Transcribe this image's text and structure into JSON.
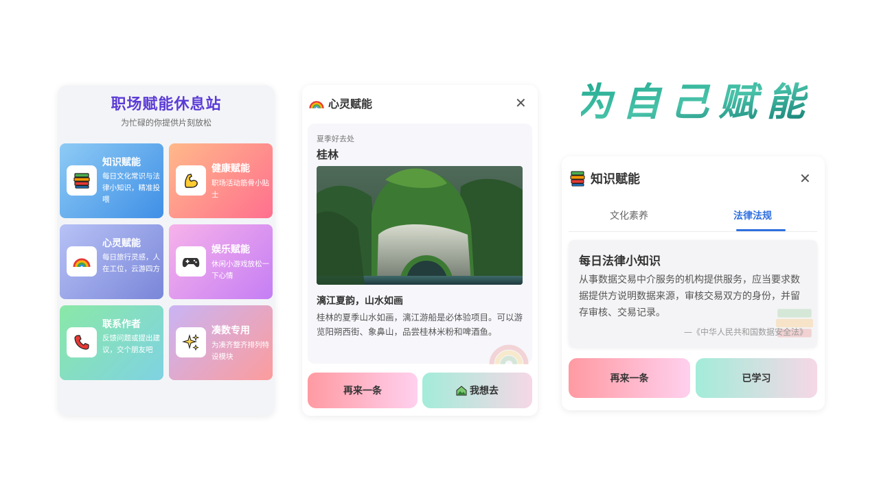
{
  "home": {
    "title": "职场赋能休息站",
    "subtitle": "为忙碌的你提供片刻放松",
    "tiles": [
      {
        "name": "知识赋能",
        "desc": "每日文化常识与法律小知识，精准投喂",
        "icon": "books-icon",
        "gradient": [
          "#8ecbf5",
          "#3f8fe6"
        ]
      },
      {
        "name": "健康赋能",
        "desc": "职场活动筋骨小贴士",
        "icon": "flexed-biceps-icon",
        "gradient": [
          "#ffb98a",
          "#ff6f8e"
        ]
      },
      {
        "name": "心灵赋能",
        "desc": "每日旅行灵感，人在工位，云游四方",
        "icon": "rainbow-icon",
        "gradient": [
          "#b7c2f6",
          "#7a86d8"
        ]
      },
      {
        "name": "娱乐赋能",
        "desc": "休闲小游戏放松一下心情",
        "icon": "game-controller-icon",
        "gradient": [
          "#f7b2ea",
          "#c57ef4"
        ]
      },
      {
        "name": "联系作者",
        "desc": "反馈问题或提出建议，交个朋友吧",
        "icon": "telephone-icon",
        "gradient": [
          "#8ae8a7",
          "#7fd2e2"
        ]
      },
      {
        "name": "凑数专用",
        "desc": "为凑齐整齐排列特设模块",
        "icon": "sparkles-icon",
        "gradient": [
          "#c9b4f5",
          "#fc9c9c"
        ]
      }
    ]
  },
  "soul": {
    "title": "心灵赋能",
    "eyebrow": "夏季好去处",
    "place": "桂林",
    "heading": "漓江夏韵，山水如画",
    "body": "桂林的夏季山水如画，漓江游船是必体验项目。可以游览阳朔西街、象鼻山，品尝桂林米粉和啤酒鱼。",
    "close": "✕",
    "btn_next": "再来一条",
    "btn_go": "我想去"
  },
  "banner": {
    "text": "为自己赋能"
  },
  "knowledge": {
    "title": "知识赋能",
    "close": "✕",
    "tabs": [
      "文化素养",
      "法律法规"
    ],
    "active_tab": 1,
    "card_title": "每日法律小知识",
    "card_body": "从事数据交易中介服务的机构提供服务，应当要求数据提供方说明数据来源，审核交易双方的身份，并留存审核、交易记录。",
    "card_source": "—《中华人民共和国数据安全法》",
    "btn_next": "再来一条",
    "btn_done": "已学习"
  },
  "colors": {
    "home_title": "#5b3bd6",
    "active_tab": "#2f6fe0",
    "btn_pink": [
      "#ff9aa2",
      "#ffd0ee"
    ],
    "btn_teal": [
      "#a3ecd9",
      "#f6d7e6"
    ]
  }
}
